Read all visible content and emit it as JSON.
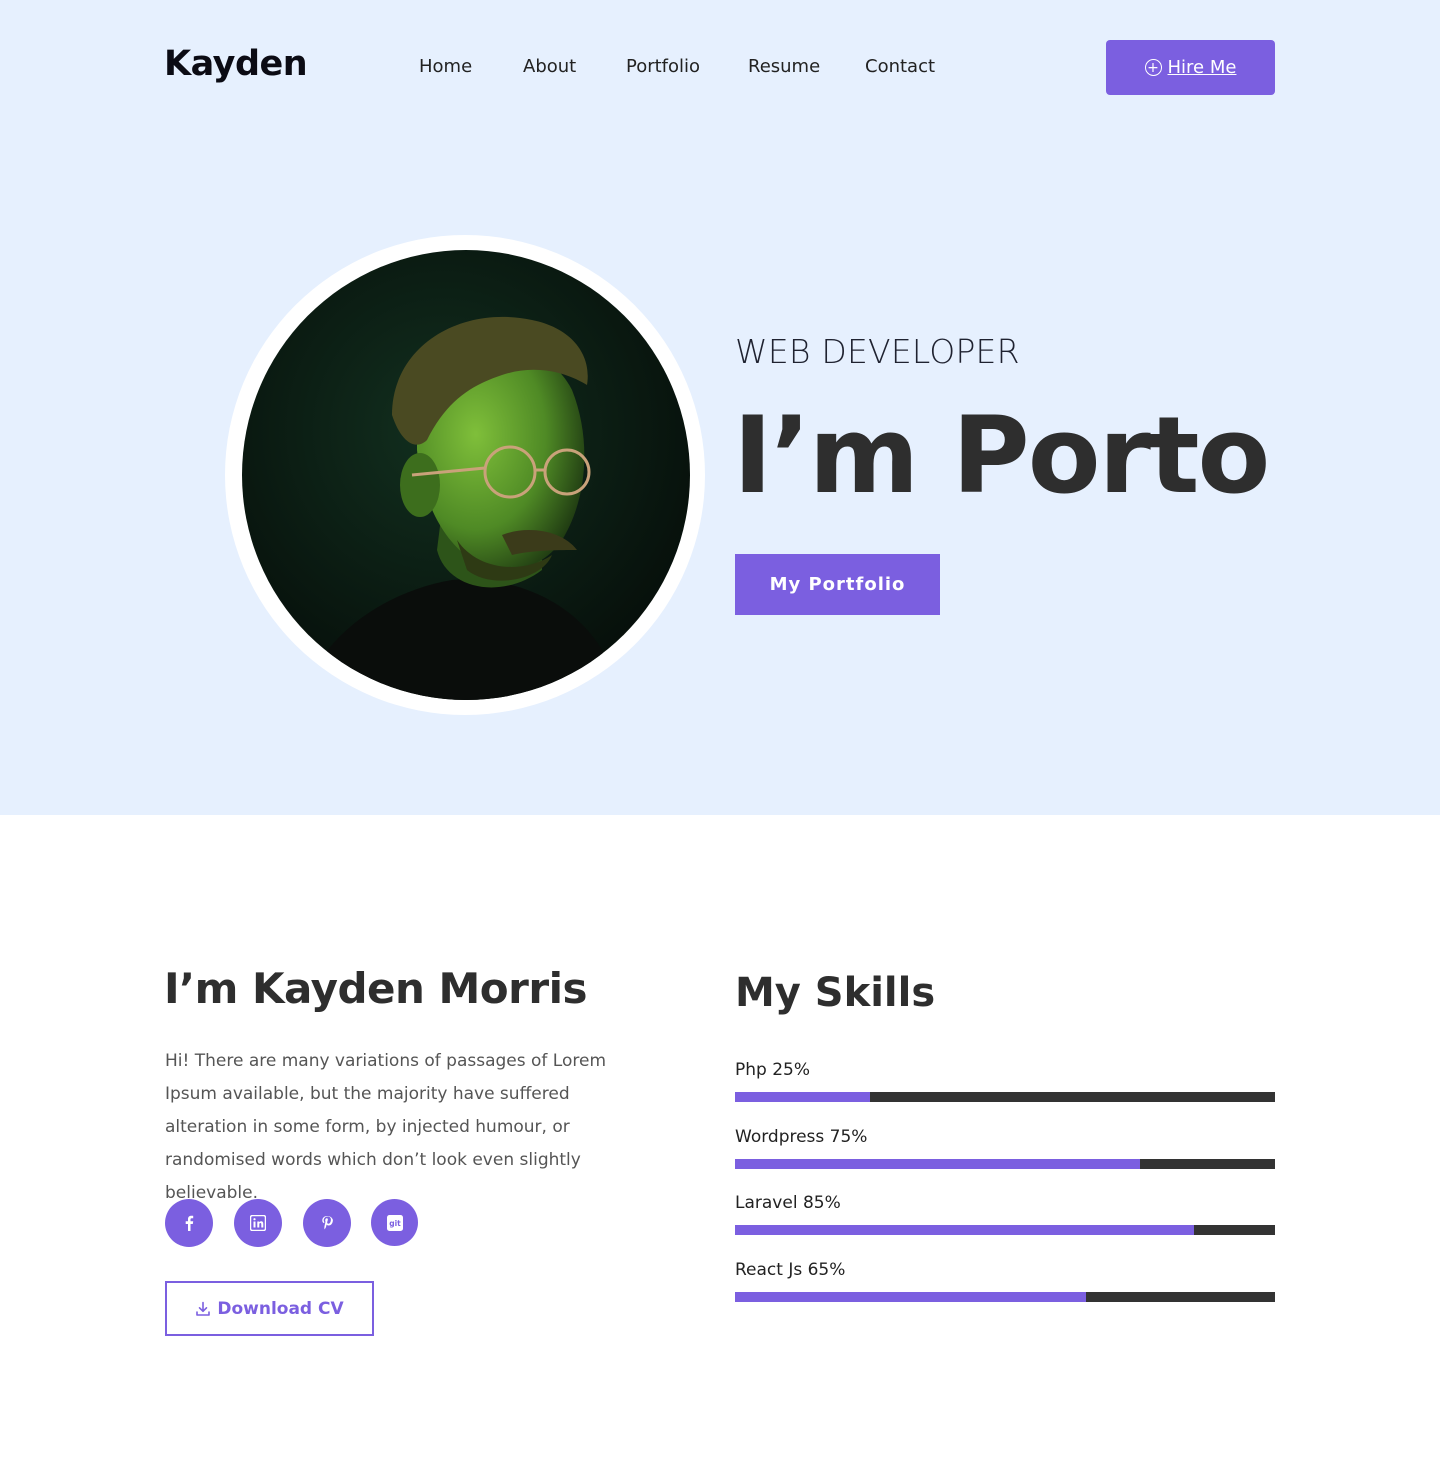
{
  "brand": {
    "name": "Kayden"
  },
  "nav": {
    "items": [
      {
        "label": "Home"
      },
      {
        "label": "About"
      },
      {
        "label": "Portfolio"
      },
      {
        "label": "Resume"
      },
      {
        "label": "Contact"
      }
    ],
    "hire_button": {
      "icon": "plus-circle-icon",
      "label": "Hire Me"
    }
  },
  "hero": {
    "subtitle": "WEB DEVELOPER",
    "title": "I’m Porto",
    "cta_label": "My Portfolio",
    "photo": "portrait-photo"
  },
  "about": {
    "title": "I’m Kayden Morris",
    "text": "Hi! There are many variations of passages of Lorem Ipsum available, but the majority have suffered alteration in some form, by injected humour, or randomised words which don’t look even slightly believable.",
    "socials": [
      {
        "icon": "facebook-icon"
      },
      {
        "icon": "linkedin-icon"
      },
      {
        "icon": "pinterest-icon"
      },
      {
        "icon": "git-icon"
      }
    ],
    "download": {
      "icon": "download-icon",
      "label": "Download CV"
    }
  },
  "skills": {
    "title": "My Skills",
    "items": [
      {
        "label": "Php 25%",
        "level": 0.25
      },
      {
        "label": "Wordpress 75%",
        "level": 0.75
      },
      {
        "label": "Laravel 85%",
        "level": 0.85
      },
      {
        "label": "React Js 65%",
        "level": 0.65
      }
    ]
  },
  "colors": {
    "accent": "#7b5fe0",
    "hero_background": "#e6f0fe",
    "bar_track": "#333333",
    "heading": "#2e2e2e"
  }
}
